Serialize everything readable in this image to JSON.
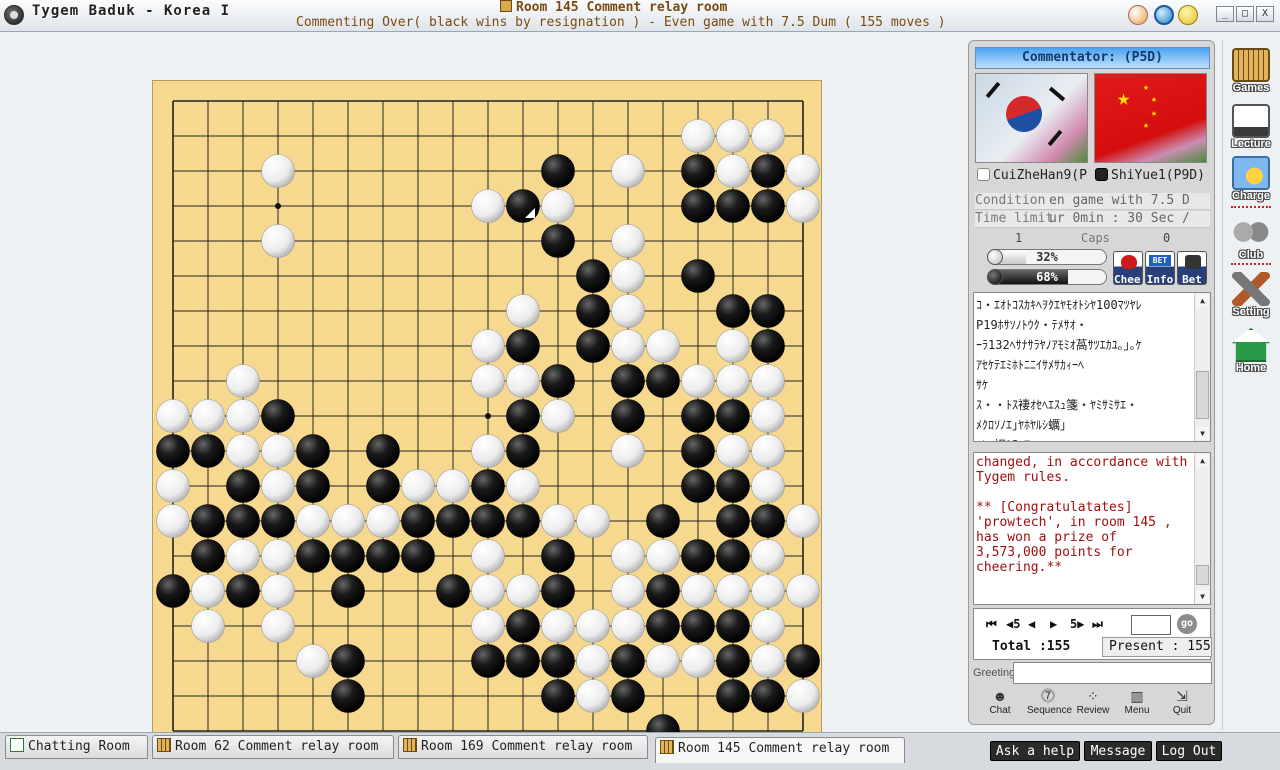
{
  "window": {
    "app_title": "Tygem Baduk - Korea I",
    "room_title": "Room 145 Comment relay room",
    "game_status": "Commenting Over( black wins by resignation ) - Even game with 7.5 Dum  ( 155 moves )",
    "min_label": "_",
    "max_label": "□",
    "close_label": "X"
  },
  "panel": {
    "commentator": "Commentator: (P5D)",
    "black_player": "CuiZheHan9(P",
    "white_player": "ShiYue1(P9D)",
    "condition_label": "Condition",
    "condition_value": "en game with 7.5 D",
    "time_label": "Time limit",
    "time_value": "ur 0min : 30 Sec /",
    "caps_label": "Caps",
    "caps_black": "1",
    "caps_white": "0",
    "white_pct": "32%",
    "white_pct_value": 32,
    "black_pct": "68%",
    "black_pct_value": 68,
    "cheer_label": "Cheer",
    "info_label": "Info",
    "bet_label": "Bet",
    "chat_lines": [
      "ｺ・ｴｵﾄｺｽｶｷﾍｦｸｴﾔﾓｵﾄｼﾔ100ﾏﾂﾔﾚ",
      "P19ﾎｻｿﾉﾄｳｸ・ﾃﾒｻｵ・",
      "ｰﾗ132ﾍｻﾅｻﾗﾔﾉｱﾓﾐｵ萵ｻﾂｴｶﾕ｡｣｡ｹ",
      "ｱｾｹﾃｴﾐﾎﾄﾆﾆｲｻﾒｻｶｨｰﾍ",
      "ｻｹ",
      "ｽ・・ﾄｽ褄ｵｾﾍｴｽｭ箋・ﾔﾐｻﾐｻｴ・",
      "ﾒｸﾛｿﾉｴ｣ﾔﾎﾔﾙｼ蠣｣",
      "ｺﾚﾆ袒ﾐﾃﾌｱ｡"
    ],
    "comment_text": "changed, in accordance with\nTygem rules.\n\n** [Congratulatates]\n'prowtech', in room 145 ,\nhas won a prize of\n3,573,000 points for\ncheering.**",
    "nav": {
      "first": "⏮",
      "back5": "4̶5",
      "back": "◀",
      "fwd": "▶",
      "fwd5": "5▶",
      "last": "⏭",
      "go": "go",
      "total": "Total :155",
      "present": "Present : 155"
    },
    "greeting_label": "Greeting",
    "tools": {
      "chat": "Chat",
      "sequence": "Sequence",
      "review": "Review",
      "menu": "Menu",
      "quit": "Quit"
    }
  },
  "sidebar": {
    "games": "Games",
    "lecture": "Lecture",
    "charge": "Charge",
    "club": "Club",
    "setting": "Setting",
    "home": "Home"
  },
  "tabs": {
    "chat": "Chatting Room",
    "r62": "Room 62 Comment relay room",
    "r169": "Room 169 Comment relay room",
    "r145": "Room 145 Comment relay room"
  },
  "bottom_buttons": {
    "help": "Ask a help",
    "message": "Message",
    "logout": "Log Out"
  },
  "board": {
    "size": 19,
    "last_move": [
      10,
      3
    ],
    "stones": [
      {
        "c": "w",
        "p": [
          [
            15,
            1
          ],
          [
            16,
            1
          ],
          [
            17,
            1
          ],
          [
            3,
            2
          ],
          [
            13,
            2
          ],
          [
            16,
            2
          ],
          [
            18,
            2
          ],
          [
            9,
            3
          ],
          [
            11,
            3
          ],
          [
            13,
            4
          ],
          [
            18,
            3
          ],
          [
            3,
            4
          ],
          [
            13,
            5
          ],
          [
            10,
            6
          ],
          [
            13,
            6
          ],
          [
            9,
            7
          ],
          [
            13,
            7
          ],
          [
            14,
            7
          ],
          [
            16,
            7
          ],
          [
            9,
            8
          ],
          [
            10,
            8
          ],
          [
            15,
            8
          ],
          [
            16,
            8
          ],
          [
            17,
            8
          ],
          [
            2,
            8
          ],
          [
            0,
            9
          ],
          [
            1,
            9
          ],
          [
            2,
            9
          ],
          [
            11,
            9
          ],
          [
            17,
            9
          ],
          [
            2,
            10
          ],
          [
            3,
            10
          ],
          [
            9,
            10
          ],
          [
            13,
            10
          ],
          [
            16,
            10
          ],
          [
            17,
            10
          ],
          [
            0,
            11
          ],
          [
            3,
            11
          ],
          [
            7,
            11
          ],
          [
            8,
            11
          ],
          [
            10,
            11
          ],
          [
            17,
            11
          ],
          [
            0,
            12
          ],
          [
            4,
            12
          ],
          [
            5,
            12
          ],
          [
            6,
            12
          ],
          [
            11,
            12
          ],
          [
            12,
            12
          ],
          [
            18,
            12
          ],
          [
            2,
            13
          ],
          [
            3,
            13
          ],
          [
            9,
            13
          ],
          [
            13,
            13
          ],
          [
            14,
            13
          ],
          [
            17,
            13
          ],
          [
            1,
            14
          ],
          [
            3,
            14
          ],
          [
            9,
            14
          ],
          [
            10,
            14
          ],
          [
            13,
            14
          ],
          [
            15,
            14
          ],
          [
            16,
            14
          ],
          [
            17,
            14
          ],
          [
            18,
            14
          ],
          [
            1,
            15
          ],
          [
            3,
            15
          ],
          [
            9,
            15
          ],
          [
            11,
            15
          ],
          [
            12,
            15
          ],
          [
            13,
            15
          ],
          [
            17,
            15
          ],
          [
            4,
            16
          ],
          [
            12,
            16
          ],
          [
            14,
            16
          ],
          [
            15,
            16
          ],
          [
            17,
            16
          ],
          [
            12,
            17
          ],
          [
            18,
            17
          ]
        ]
      },
      {
        "c": "b",
        "p": [
          [
            11,
            2
          ],
          [
            15,
            2
          ],
          [
            17,
            2
          ],
          [
            10,
            3
          ],
          [
            15,
            3
          ],
          [
            16,
            3
          ],
          [
            17,
            3
          ],
          [
            11,
            4
          ],
          [
            12,
            5
          ],
          [
            15,
            5
          ],
          [
            12,
            6
          ],
          [
            16,
            6
          ],
          [
            17,
            6
          ],
          [
            10,
            7
          ],
          [
            12,
            7
          ],
          [
            17,
            7
          ],
          [
            11,
            8
          ],
          [
            13,
            8
          ],
          [
            14,
            8
          ],
          [
            3,
            9
          ],
          [
            10,
            9
          ],
          [
            13,
            9
          ],
          [
            15,
            9
          ],
          [
            16,
            9
          ],
          [
            0,
            10
          ],
          [
            1,
            10
          ],
          [
            4,
            10
          ],
          [
            6,
            10
          ],
          [
            10,
            10
          ],
          [
            15,
            10
          ],
          [
            2,
            11
          ],
          [
            4,
            11
          ],
          [
            6,
            11
          ],
          [
            9,
            11
          ],
          [
            15,
            11
          ],
          [
            16,
            11
          ],
          [
            1,
            12
          ],
          [
            2,
            12
          ],
          [
            3,
            12
          ],
          [
            7,
            12
          ],
          [
            8,
            12
          ],
          [
            9,
            12
          ],
          [
            10,
            12
          ],
          [
            14,
            12
          ],
          [
            16,
            12
          ],
          [
            17,
            12
          ],
          [
            1,
            13
          ],
          [
            4,
            13
          ],
          [
            5,
            13
          ],
          [
            6,
            13
          ],
          [
            7,
            13
          ],
          [
            11,
            13
          ],
          [
            15,
            13
          ],
          [
            16,
            13
          ],
          [
            0,
            14
          ],
          [
            2,
            14
          ],
          [
            5,
            14
          ],
          [
            8,
            14
          ],
          [
            11,
            14
          ],
          [
            14,
            14
          ],
          [
            10,
            15
          ],
          [
            14,
            15
          ],
          [
            15,
            15
          ],
          [
            16,
            15
          ],
          [
            5,
            16
          ],
          [
            9,
            16
          ],
          [
            10,
            16
          ],
          [
            11,
            16
          ],
          [
            13,
            16
          ],
          [
            16,
            16
          ],
          [
            18,
            16
          ],
          [
            5,
            17
          ],
          [
            11,
            17
          ],
          [
            13,
            17
          ],
          [
            16,
            17
          ],
          [
            17,
            17
          ],
          [
            14,
            18
          ]
        ]
      }
    ]
  }
}
